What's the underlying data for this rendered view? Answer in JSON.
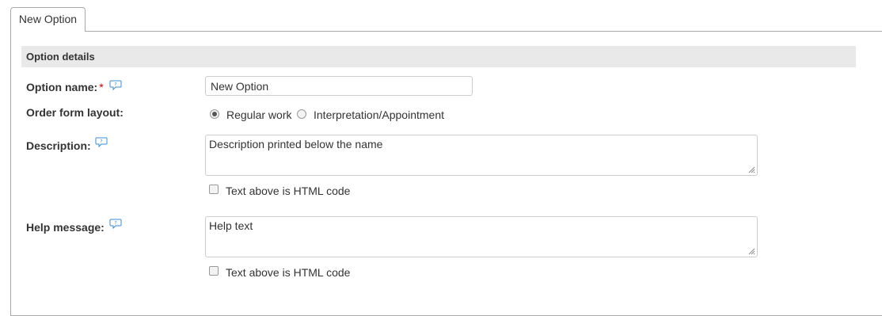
{
  "tabs": [
    {
      "label": "New Option",
      "active": true
    }
  ],
  "section": {
    "title": "Option details"
  },
  "fields": {
    "option_name": {
      "label": "Option name:",
      "required_mark": "*",
      "value": "New Option"
    },
    "order_form_layout": {
      "label": "Order form layout:",
      "options": [
        {
          "label": "Regular work",
          "selected": true
        },
        {
          "label": "Interpretation/Appointment",
          "selected": false
        }
      ]
    },
    "description": {
      "label": "Description:",
      "value": "Description printed below the name",
      "html_checkbox_label": "Text above is HTML code",
      "html_checked": false
    },
    "help_message": {
      "label": "Help message:",
      "value": "Help text",
      "html_checkbox_label": "Text above is HTML code",
      "html_checked": false
    }
  },
  "icons": {
    "help": "speech-bubble-question-icon",
    "resize": "resize-grip-icon"
  },
  "colors": {
    "section_bg": "#e9e9e9",
    "required": "#cc0000",
    "help_icon": "#3a8fd6"
  }
}
